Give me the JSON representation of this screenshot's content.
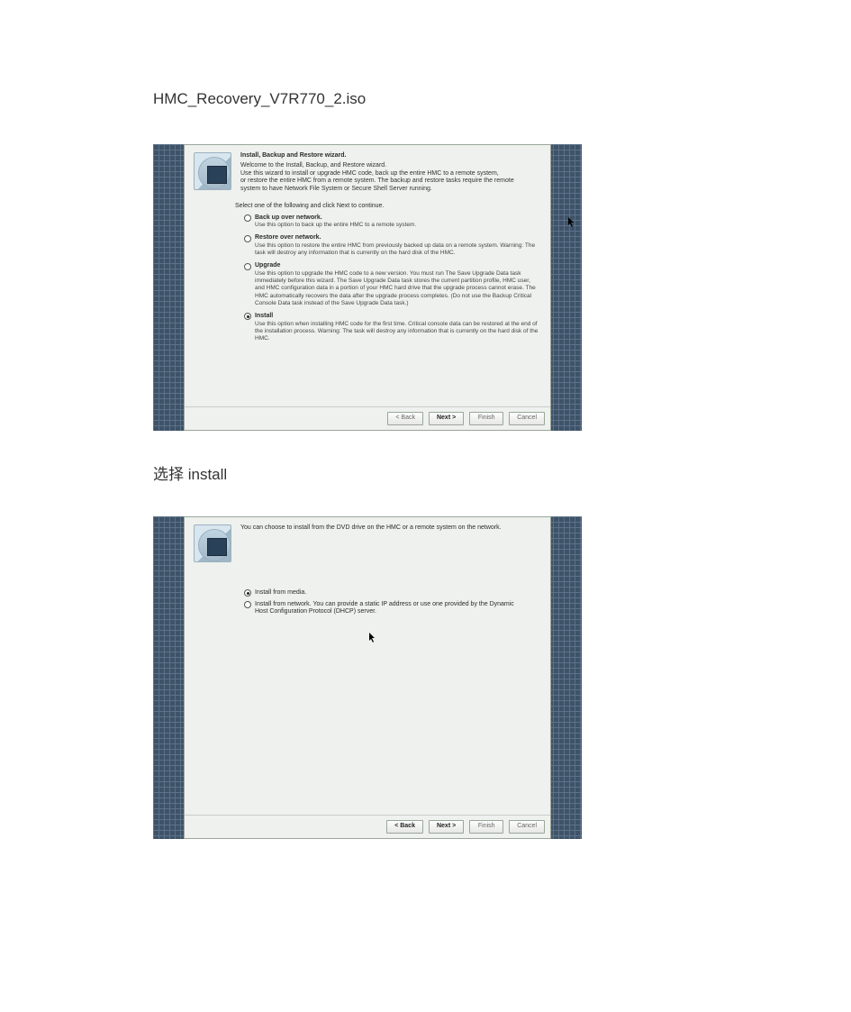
{
  "doc": {
    "heading": "HMC_Recovery_V7R770_2.iso",
    "caption": "选择 install"
  },
  "screenshot1": {
    "intro": {
      "title": "Install, Backup and Restore wizard.",
      "l1": "Welcome to the Install, Backup, and Restore wizard.",
      "l2": "Use this wizard to install or upgrade HMC code, back up the entire HMC to a remote system,",
      "l3": "or restore the entire HMC from a remote system. The backup and restore tasks require the remote",
      "l4": "system to have Network File System or Secure Shell Server running."
    },
    "select_text": "Select one of the following and click Next to continue.",
    "options": [
      {
        "label": "Back up over network.",
        "desc": "Use this option to back up the entire HMC to a remote system."
      },
      {
        "label": "Restore over network.",
        "desc": "Use this option to restore the entire HMC from previously backed up data on a remote system. Warning: The task will destroy any information that is currently on the hard disk of the HMC."
      },
      {
        "label": "Upgrade",
        "desc": "Use this option to upgrade the HMC code to a new version. You must run The Save Upgrade Data task immediately before this wizard. The Save Upgrade Data task stores the current partition profile, HMC user, and HMC configuration data in a portion of your HMC hard drive that the upgrade process cannot erase. The HMC automatically recovers the data after the upgrade process completes. (Do not use the Backup Critical Console Data task instead of the Save Upgrade Data task.)"
      },
      {
        "label": "Install",
        "desc": "Use this option when installing HMC code for the first time. Critical console data can be restored at the end of the installation process. Warning: The task will destroy any information that is currently on the hard disk of the HMC."
      }
    ],
    "selected": 3,
    "buttons": {
      "back": "< Back",
      "next": "Next >",
      "finish": "Finish",
      "cancel": "Cancel"
    }
  },
  "screenshot2": {
    "intro": {
      "line": "You can choose to install from the DVD drive on the HMC or a remote system on the network."
    },
    "options": [
      {
        "label": "Install from media."
      },
      {
        "label": "Install from network. You can provide a static IP address or use one provided by the Dynamic Host Configuration Protocol (DHCP) server."
      }
    ],
    "selected": 0,
    "buttons": {
      "back": "< Back",
      "next": "Next >",
      "finish": "Finish",
      "cancel": "Cancel"
    }
  }
}
